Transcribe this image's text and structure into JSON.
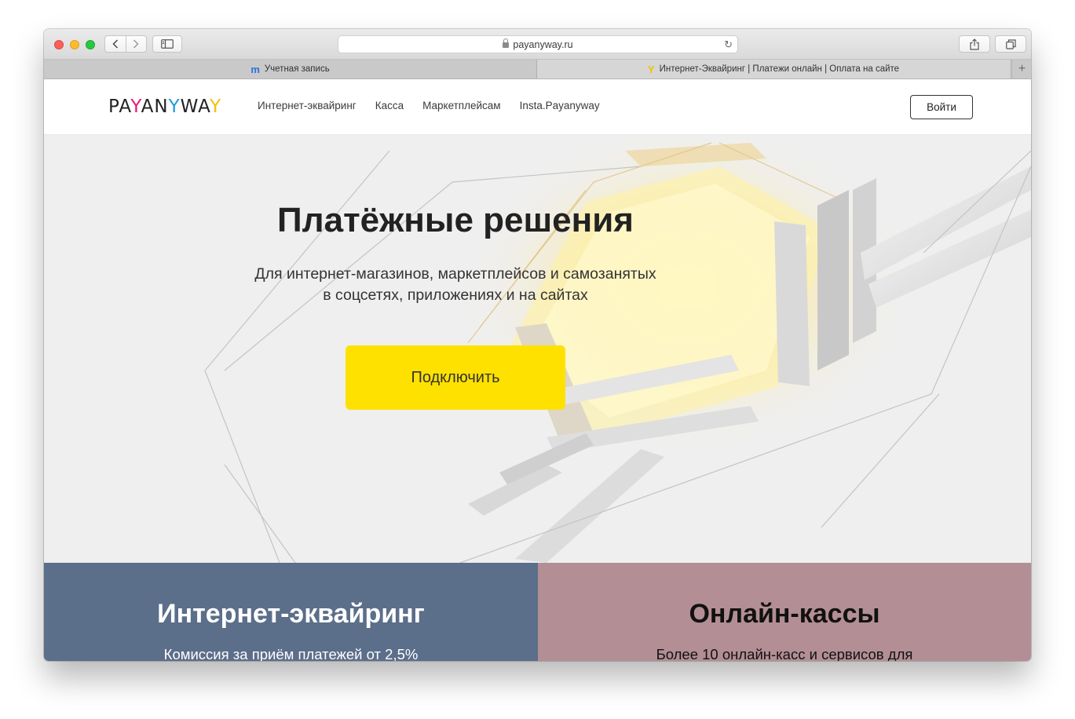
{
  "browser": {
    "url": "payanyway.ru",
    "tabs": [
      {
        "label": "Учетная запись",
        "favicon": "m"
      },
      {
        "label": "Интернет-Эквайринг | Платежи онлайн | Оплата на сайте",
        "favicon": "Y"
      }
    ]
  },
  "header": {
    "logo": {
      "p1": "PA",
      "y1": "Y",
      "p2": "AN",
      "y2": "Y",
      "p3": "WA",
      "y3": "Y"
    },
    "nav": [
      "Интернет-эквайринг",
      "Касса",
      "Маркетплейсам",
      "Insta.Payanyway"
    ],
    "login_label": "Войти"
  },
  "hero": {
    "title": "Платёжные решения",
    "subtitle_line1": "Для интернет-магазинов, маркетплейсов и самозанятых",
    "subtitle_line2": "в соцсетях, приложениях и на сайтах",
    "cta_label": "Подключить"
  },
  "cards": [
    {
      "title": "Интернет-эквайринг",
      "subtitle": "Комиссия за приём платежей от 2,5%",
      "color": "#5b6e8a"
    },
    {
      "title": "Онлайн-кассы",
      "subtitle": "Более 10 онлайн-касс и сервисов для",
      "color": "#b38e95"
    }
  ],
  "colors": {
    "accent": "#ffe100",
    "logo_pink": "#e6197a",
    "logo_blue": "#1a9ed9",
    "logo_yellow": "#f2c300"
  },
  "icons": [
    "back-icon",
    "forward-icon",
    "sidebar-icon",
    "lock-icon",
    "reload-icon",
    "share-icon",
    "tabs-icon",
    "new-tab-icon"
  ]
}
